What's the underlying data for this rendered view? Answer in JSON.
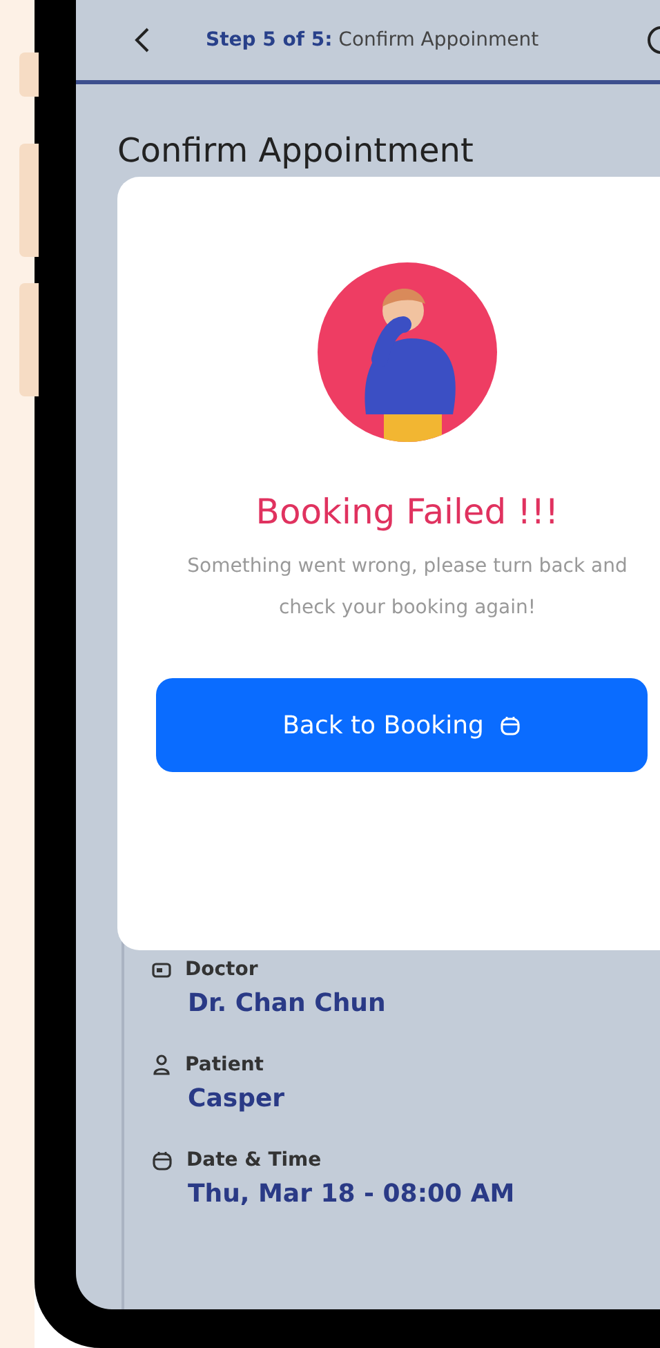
{
  "header": {
    "step": "Step 5 of 5:",
    "title": "Confirm Appoinment"
  },
  "heading": "Confirm Appointment",
  "details": [
    {
      "kind": "doctor",
      "label": "Doctor",
      "value": "Dr. Chan Chun"
    },
    {
      "kind": "patient",
      "label": "Patient",
      "value": "Casper"
    },
    {
      "kind": "date",
      "label": "Date & Time",
      "value": "Thu, Mar 18 - 08:00 AM"
    }
  ],
  "dialog": {
    "title": "Booking Failed !!!",
    "message": "Something went wrong, please turn back and check your booking again!",
    "button": "Back to Booking"
  }
}
